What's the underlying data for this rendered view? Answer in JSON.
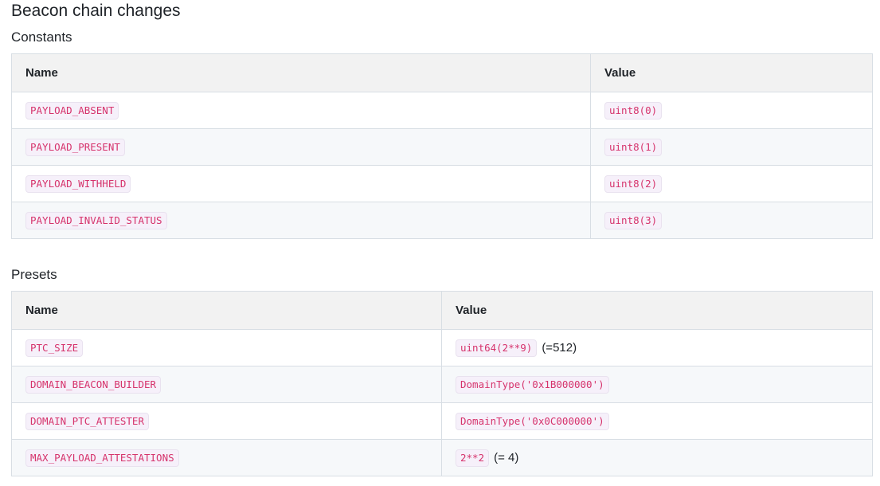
{
  "heading": "Beacon chain changes",
  "constants": {
    "title": "Constants",
    "col_name": "Name",
    "col_value": "Value",
    "rows": [
      {
        "name": "PAYLOAD_ABSENT",
        "value": "uint8(0)"
      },
      {
        "name": "PAYLOAD_PRESENT",
        "value": "uint8(1)"
      },
      {
        "name": "PAYLOAD_WITHHELD",
        "value": "uint8(2)"
      },
      {
        "name": "PAYLOAD_INVALID_STATUS",
        "value": "uint8(3)"
      }
    ]
  },
  "presets": {
    "title": "Presets",
    "col_name": "Name",
    "col_value": "Value",
    "rows": [
      {
        "name": "PTC_SIZE",
        "value": "uint64(2**9)",
        "note": "(=512)"
      },
      {
        "name": "DOMAIN_BEACON_BUILDER",
        "value": "DomainType('0x1B000000')",
        "note": ""
      },
      {
        "name": "DOMAIN_PTC_ATTESTER",
        "value": "DomainType('0x0C000000')",
        "note": ""
      },
      {
        "name": "MAX_PAYLOAD_ATTESTATIONS",
        "value": "2**2",
        "note": "(= 4)"
      }
    ]
  }
}
